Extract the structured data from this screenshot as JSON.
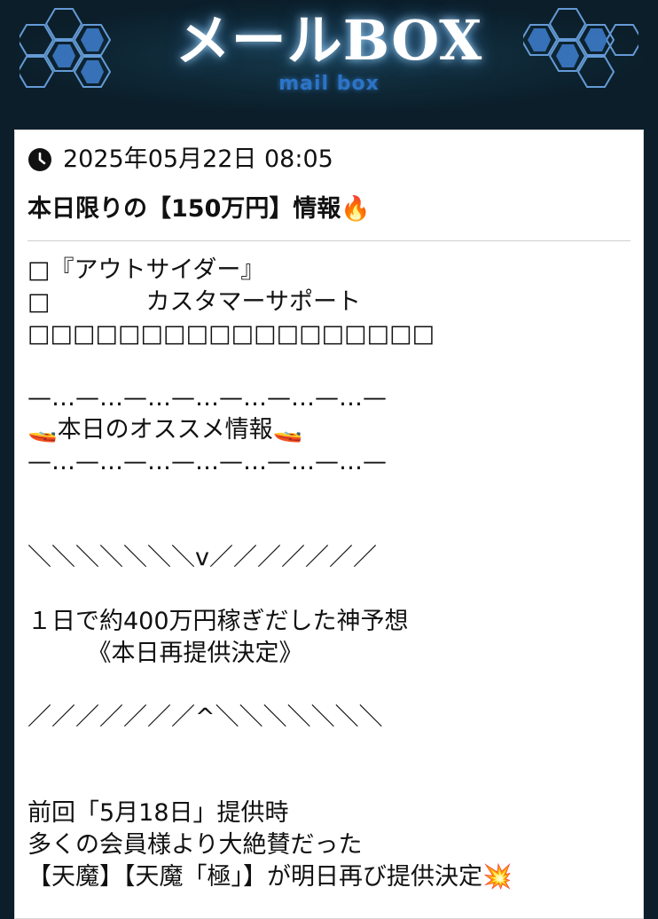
{
  "header": {
    "title": "メールBOX",
    "subtitle": "mail box"
  },
  "message": {
    "timestamp": "2025年05月22日 08:05",
    "subject": "本日限りの【150万円】情報🔥",
    "lines": [
      "□『アウトサイダー』",
      "□　　　　カスタマーサポート",
      "□□□□□□□□□□□□□□□□□□",
      "",
      "—…—…—…—…—…—…—…—",
      "🚤本日のオススメ情報🚤",
      "—…—…—…—…—…—…—…—",
      "",
      "",
      "＼＼＼＼＼＼＼v／／／／／／／",
      "",
      "１日で約400万円稼ぎだした神予想",
      "　　　《本日再提供決定》",
      "",
      "／／／／／／／^＼＼＼＼＼＼＼",
      "",
      "",
      "前回「5月18日」提供時",
      "多くの会員様より大絶賛だった",
      "【天魔】【天魔「極」】が明日再び提供決定💥"
    ]
  },
  "colors": {
    "background": "#0b1e2a",
    "card": "#ffffff",
    "accent": "#2c74c8"
  },
  "icons": {
    "clock": "clock-icon",
    "fire": "fire-emoji",
    "boat": "boat-emoji",
    "explosion": "explosion-emoji"
  }
}
